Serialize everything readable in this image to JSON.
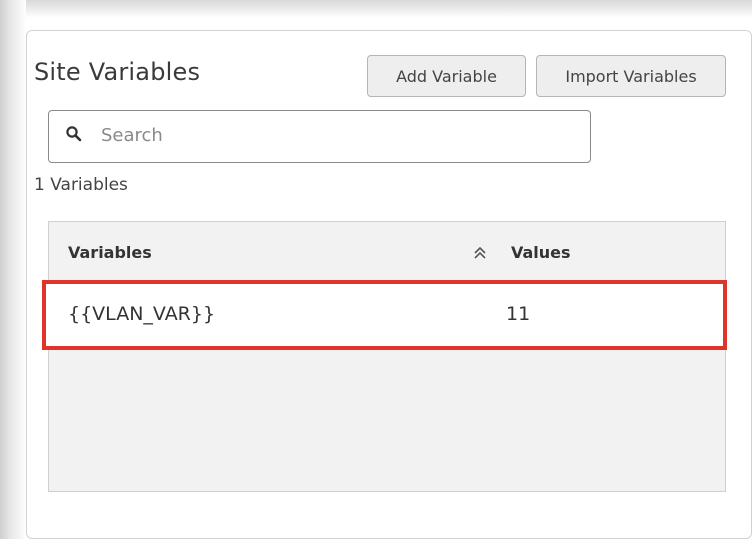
{
  "panel": {
    "title": "Site Variables",
    "buttons": {
      "add_variable": "Add Variable",
      "import_variables": "Import Variables"
    },
    "search": {
      "placeholder": "Search",
      "icon": "search-icon"
    },
    "count_text": "1 Variables",
    "table": {
      "columns": [
        "Variables",
        "Values"
      ],
      "sort_icon": "sort-up-double-chevron-icon",
      "rows": [
        {
          "variable": "{{VLAN_VAR}}",
          "value": "11"
        }
      ]
    },
    "colors": {
      "highlight": "#e0332a",
      "table_bg": "#f2f2f2"
    }
  }
}
